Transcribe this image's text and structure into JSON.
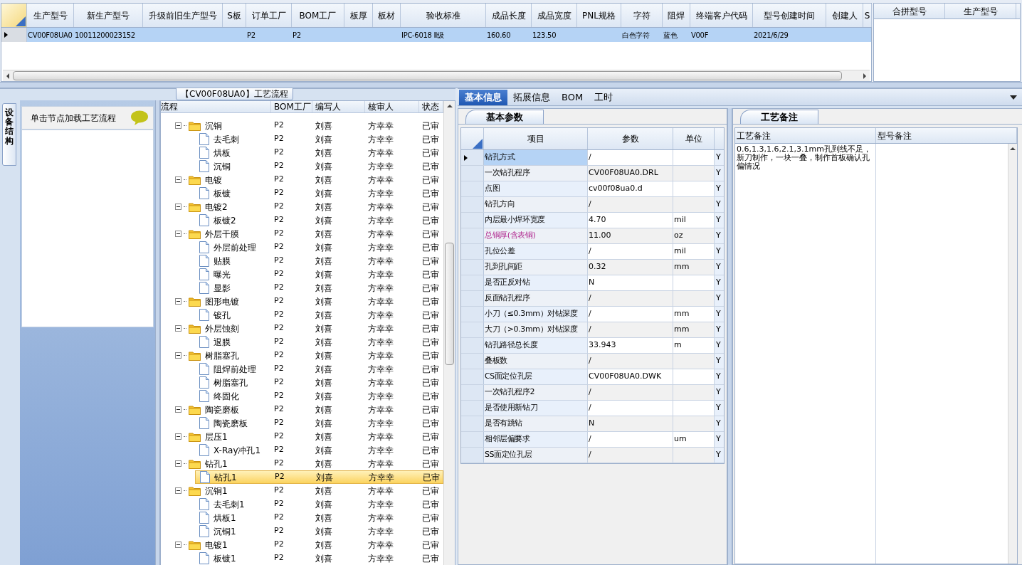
{
  "top_grid": {
    "columns": [
      "生产型号",
      "新生产型号",
      "升级前旧生产型号",
      "S板",
      "订单工厂",
      "BOM工厂",
      "板厚",
      "板材",
      "验收标准",
      "成品长度",
      "成品宽度",
      "PNL规格",
      "字符",
      "阻焊",
      "终端客户代码",
      "型号创建时间",
      "创建人",
      "S"
    ],
    "rows": [
      {
        "selected": true,
        "cells": [
          {
            "text": "CV00F08UA0"
          },
          {
            "text": "10011200023152"
          },
          {},
          {},
          {
            "text": "P2"
          },
          {
            "text": "P2"
          },
          {},
          {},
          {
            "text": "IPC-6018 Ⅱ级"
          },
          {
            "text": "160.60"
          },
          {
            "text": "123.50"
          },
          {},
          {
            "text": "白色字符"
          },
          {
            "text": "蓝色"
          },
          {
            "text": "V00F"
          },
          {
            "text": "2021/6/29"
          },
          {},
          {}
        ]
      }
    ]
  },
  "merge_grid": {
    "columns": [
      "合拼型号",
      "生产型号"
    ]
  },
  "process_panel": {
    "title": "【CV00F08UA0】工艺流程",
    "side_tab": "设备结构",
    "hint": "单击节点加载工艺流程"
  },
  "process_tree": {
    "columns": [
      "流程",
      "BOM工厂",
      "编写人",
      "核审人",
      "状态"
    ],
    "nodes": [
      {
        "name": "沉铜",
        "bom_factory": "P2",
        "author": "刘喜",
        "reviewer": "方幸幸",
        "status": "已审",
        "selected": false,
        "expanded": true,
        "children": [
          {
            "name": "去毛刺",
            "bom_factory": "P2",
            "author": "刘喜",
            "reviewer": "方幸幸",
            "status": "已审",
            "selected": false
          },
          {
            "name": "烘板",
            "bom_factory": "P2",
            "author": "刘喜",
            "reviewer": "方幸幸",
            "status": "已审",
            "selected": false
          },
          {
            "name": "沉铜",
            "bom_factory": "P2",
            "author": "刘喜",
            "reviewer": "方幸幸",
            "status": "已审",
            "selected": false
          }
        ]
      },
      {
        "name": "电镀",
        "bom_factory": "P2",
        "author": "刘喜",
        "reviewer": "方幸幸",
        "status": "已审",
        "selected": false,
        "expanded": true,
        "children": [
          {
            "name": "板镀",
            "bom_factory": "P2",
            "author": "刘喜",
            "reviewer": "方幸幸",
            "status": "已审",
            "selected": false
          }
        ]
      },
      {
        "name": "电镀2",
        "bom_factory": "P2",
        "author": "刘喜",
        "reviewer": "方幸幸",
        "status": "已审",
        "selected": false,
        "expanded": true,
        "children": [
          {
            "name": "板镀2",
            "bom_factory": "P2",
            "author": "刘喜",
            "reviewer": "方幸幸",
            "status": "已审",
            "selected": false
          }
        ]
      },
      {
        "name": "外层干膜",
        "bom_factory": "P2",
        "author": "刘喜",
        "reviewer": "方幸幸",
        "status": "已审",
        "selected": false,
        "expanded": true,
        "children": [
          {
            "name": "外层前处理",
            "bom_factory": "P2",
            "author": "刘喜",
            "reviewer": "方幸幸",
            "status": "已审",
            "selected": false
          },
          {
            "name": "贴膜",
            "bom_factory": "P2",
            "author": "刘喜",
            "reviewer": "方幸幸",
            "status": "已审",
            "selected": false
          },
          {
            "name": "曝光",
            "bom_factory": "P2",
            "author": "刘喜",
            "reviewer": "方幸幸",
            "status": "已审",
            "selected": false
          },
          {
            "name": "显影",
            "bom_factory": "P2",
            "author": "刘喜",
            "reviewer": "方幸幸",
            "status": "已审",
            "selected": false
          }
        ]
      },
      {
        "name": "图形电镀",
        "bom_factory": "P2",
        "author": "刘喜",
        "reviewer": "方幸幸",
        "status": "已审",
        "selected": false,
        "expanded": true,
        "children": [
          {
            "name": "镀孔",
            "bom_factory": "P2",
            "author": "刘喜",
            "reviewer": "方幸幸",
            "status": "已审",
            "selected": false
          }
        ]
      },
      {
        "name": "外层蚀刻",
        "bom_factory": "P2",
        "author": "刘喜",
        "reviewer": "方幸幸",
        "status": "已审",
        "selected": false,
        "expanded": true,
        "children": [
          {
            "name": "退膜",
            "bom_factory": "P2",
            "author": "刘喜",
            "reviewer": "方幸幸",
            "status": "已审",
            "selected": false
          }
        ]
      },
      {
        "name": "树脂塞孔",
        "bom_factory": "P2",
        "author": "刘喜",
        "reviewer": "方幸幸",
        "status": "已审",
        "selected": false,
        "expanded": true,
        "children": [
          {
            "name": "阻焊前处理",
            "bom_factory": "P2",
            "author": "刘喜",
            "reviewer": "方幸幸",
            "status": "已审",
            "selected": false
          },
          {
            "name": "树脂塞孔",
            "bom_factory": "P2",
            "author": "刘喜",
            "reviewer": "方幸幸",
            "status": "已审",
            "selected": false
          },
          {
            "name": "终固化",
            "bom_factory": "P2",
            "author": "刘喜",
            "reviewer": "方幸幸",
            "status": "已审",
            "selected": false
          }
        ]
      },
      {
        "name": "陶瓷磨板",
        "bom_factory": "P2",
        "author": "刘喜",
        "reviewer": "方幸幸",
        "status": "已审",
        "selected": false,
        "expanded": true,
        "children": [
          {
            "name": "陶瓷磨板",
            "bom_factory": "P2",
            "author": "刘喜",
            "reviewer": "方幸幸",
            "status": "已审",
            "selected": false
          }
        ]
      },
      {
        "name": "层压1",
        "bom_factory": "P2",
        "author": "刘喜",
        "reviewer": "方幸幸",
        "status": "已审",
        "selected": false,
        "expanded": true,
        "children": [
          {
            "name": "X-Ray冲孔1",
            "bom_factory": "P2",
            "author": "刘喜",
            "reviewer": "方幸幸",
            "status": "已审",
            "selected": false
          }
        ]
      },
      {
        "name": "钻孔1",
        "bom_factory": "P2",
        "author": "刘喜",
        "reviewer": "方幸幸",
        "status": "已审",
        "selected": false,
        "expanded": true,
        "children": [
          {
            "name": "钻孔1",
            "bom_factory": "P2",
            "author": "刘喜",
            "reviewer": "方幸幸",
            "status": "已审",
            "selected": true
          }
        ]
      },
      {
        "name": "沉铜1",
        "bom_factory": "P2",
        "author": "刘喜",
        "reviewer": "方幸幸",
        "status": "已审",
        "selected": false,
        "expanded": true,
        "children": [
          {
            "name": "去毛刺1",
            "bom_factory": "P2",
            "author": "刘喜",
            "reviewer": "方幸幸",
            "status": "已审",
            "selected": false
          },
          {
            "name": "烘板1",
            "bom_factory": "P2",
            "author": "刘喜",
            "reviewer": "方幸幸",
            "status": "已审",
            "selected": false
          },
          {
            "name": "沉铜1",
            "bom_factory": "P2",
            "author": "刘喜",
            "reviewer": "方幸幸",
            "status": "已审",
            "selected": false
          }
        ]
      },
      {
        "name": "电镀1",
        "bom_factory": "P2",
        "author": "刘喜",
        "reviewer": "方幸幸",
        "status": "已审",
        "selected": false,
        "expanded": true,
        "children": [
          {
            "name": "板镀1",
            "bom_factory": "P2",
            "author": "刘喜",
            "reviewer": "方幸幸",
            "status": "已审",
            "selected": false
          }
        ]
      }
    ]
  },
  "detail_tabs": [
    {
      "label": "基本信息",
      "selected": true
    },
    {
      "label": "拓展信息",
      "selected": false
    },
    {
      "label": "BOM",
      "selected": false
    },
    {
      "label": "工时",
      "selected": false
    }
  ],
  "params": {
    "title": "基本参数",
    "columns": [
      "项目",
      "参数",
      "单位"
    ],
    "rows": [
      {
        "item": "钻孔方式",
        "value": "/",
        "flag": "Y",
        "selected": true,
        "emphasized": false
      },
      {
        "item": "一次钻孔程序",
        "value": "CV00F08UA0.DRL",
        "flag": "Y",
        "selected": false,
        "emphasized": false
      },
      {
        "item": "点图",
        "value": "cv00f08ua0.d",
        "flag": "Y",
        "selected": false,
        "emphasized": false
      },
      {
        "item": "钻孔方向",
        "value": "/",
        "flag": "Y",
        "selected": false,
        "emphasized": false
      },
      {
        "item": "内层最小焊环宽度",
        "value": "4.70",
        "unit": "mil",
        "flag": "Y",
        "selected": false,
        "emphasized": false
      },
      {
        "item": "总铜厚(含表铜)",
        "value": "11.00",
        "unit": "oz",
        "flag": "Y",
        "selected": false,
        "emphasized": true
      },
      {
        "item": "孔位公差",
        "value": "/",
        "unit": "mil",
        "flag": "Y",
        "selected": false,
        "emphasized": false
      },
      {
        "item": "孔到孔间距",
        "value": "0.32",
        "unit": "mm",
        "flag": "Y",
        "selected": false,
        "emphasized": false
      },
      {
        "item": "是否正反对钻",
        "value": "N",
        "flag": "Y",
        "selected": false,
        "emphasized": false
      },
      {
        "item": "反面钻孔程序",
        "value": "/",
        "flag": "Y",
        "selected": false,
        "emphasized": false
      },
      {
        "item": "小刀（≤0.3mm）对钻深度",
        "value": "/",
        "unit": "mm",
        "flag": "Y",
        "selected": false,
        "emphasized": false
      },
      {
        "item": "大刀（>0.3mm）对钻深度",
        "value": "/",
        "unit": "mm",
        "flag": "Y",
        "selected": false,
        "emphasized": false
      },
      {
        "item": "钻孔路径总长度",
        "value": "33.943",
        "unit": "m",
        "flag": "Y",
        "selected": false,
        "emphasized": false
      },
      {
        "item": "叠板数",
        "value": "/",
        "flag": "Y",
        "selected": false,
        "emphasized": false
      },
      {
        "item": "CS面定位孔层",
        "value": "CV00F08UA0.DWK",
        "flag": "Y",
        "selected": false,
        "emphasized": false
      },
      {
        "item": "一次钻孔程序2",
        "value": "/",
        "flag": "Y",
        "selected": false,
        "emphasized": false
      },
      {
        "item": "是否使用新钻刀",
        "value": "/",
        "flag": "Y",
        "selected": false,
        "emphasized": false
      },
      {
        "item": "是否有跳钻",
        "value": "N",
        "flag": "Y",
        "selected": false,
        "emphasized": false
      },
      {
        "item": "相邻层偏要求",
        "value": "/",
        "unit": "um",
        "flag": "Y",
        "selected": false,
        "emphasized": false
      },
      {
        "item": "SS面定位孔层",
        "value": "/",
        "flag": "Y",
        "selected": false,
        "emphasized": false
      }
    ]
  },
  "notes": {
    "title": "工艺备注",
    "columns": [
      "工艺备注",
      "型号备注"
    ],
    "process_note": "0.6,1.3,1.6,2.1,3.1mm孔到线不足，新刀制作，一块一叠，制作首板确认孔偏情况"
  }
}
